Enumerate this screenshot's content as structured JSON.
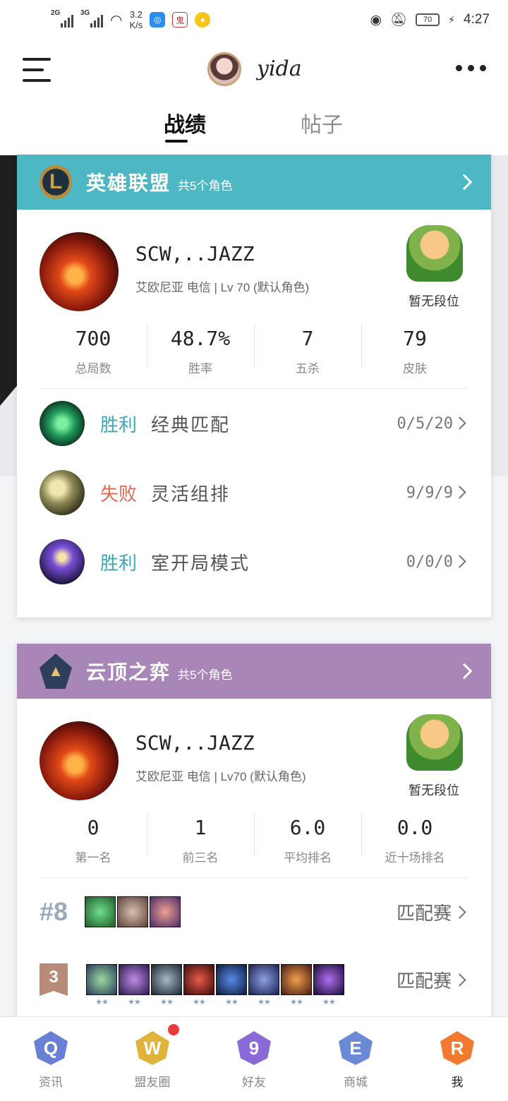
{
  "status_bar": {
    "signal1": "2G",
    "signal2": "3G",
    "speed_value": "3.2",
    "speed_unit": "K/s",
    "battery": "70",
    "time": "4:27"
  },
  "header": {
    "username": "yida",
    "tabs": [
      {
        "label": "战绩",
        "active": true
      },
      {
        "label": "帖子",
        "active": false
      }
    ]
  },
  "lol": {
    "title": "英雄联盟",
    "subtitle": "共5个角色",
    "header_color": "#4db7c4",
    "role_name": "SCW,..JAZZ",
    "role_meta": "艾欧尼亚 电信 | Lv 70 (默认角色)",
    "rank": "暂无段位",
    "stats": [
      {
        "value": "700",
        "label": "总局数"
      },
      {
        "value": "48.7%",
        "label": "胜率"
      },
      {
        "value": "7",
        "label": "五杀"
      },
      {
        "value": "79",
        "label": "皮肤"
      }
    ],
    "matches": [
      {
        "result": "胜利",
        "mode": "经典匹配",
        "kda": "0/5/20"
      },
      {
        "result": "失败",
        "mode": "灵活组排",
        "kda": "9/9/9"
      },
      {
        "result": "胜利",
        "mode": "室开局模式",
        "kda": "0/0/0"
      }
    ]
  },
  "tft": {
    "title": "云顶之弈",
    "subtitle": "共5个角色",
    "header_color": "#a886b8",
    "role_name": "SCW,..JAZZ",
    "role_meta": "艾欧尼亚 电信 | Lv70 (默认角色)",
    "rank": "暂无段位",
    "stats": [
      {
        "value": "0",
        "label": "第一名"
      },
      {
        "value": "1",
        "label": "前三名"
      },
      {
        "value": "6.0",
        "label": "平均排名"
      },
      {
        "value": "0.0",
        "label": "近十场排名"
      }
    ],
    "games": [
      {
        "place": "#8",
        "queue": "匹配赛"
      },
      {
        "place": "3",
        "queue": "匹配赛"
      }
    ]
  },
  "bottom_nav": [
    {
      "icon": "Q",
      "label": "资讯"
    },
    {
      "icon": "W",
      "label": "盟友圈"
    },
    {
      "icon": "9",
      "label": "好友"
    },
    {
      "icon": "E",
      "label": "商城"
    },
    {
      "icon": "R",
      "label": "我"
    }
  ]
}
